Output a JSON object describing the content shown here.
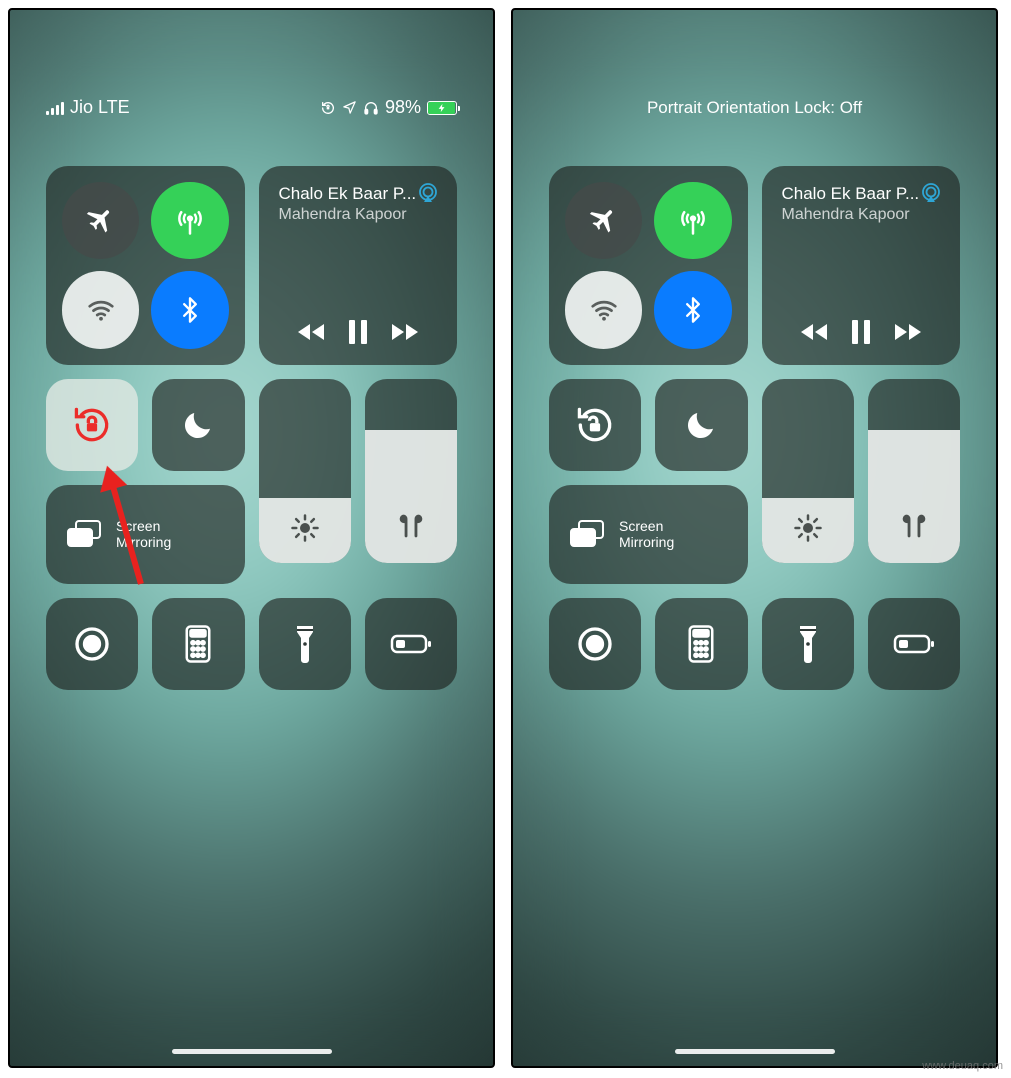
{
  "watermark": "www.deuaq.com",
  "left": {
    "status": {
      "carrier": "Jio LTE",
      "battery_percent": "98%",
      "has_lock_indicator": true
    },
    "connectivity": {
      "airplane": false,
      "cellular": true,
      "wifi": true,
      "bluetooth": true
    },
    "media": {
      "title": "Chalo Ek Baar P...",
      "artist": "Mahendra Kapoor",
      "playing": true
    },
    "orientation_lock": {
      "on": true
    },
    "dnd": {
      "on": false
    },
    "screen_mirroring": {
      "label": "Screen\nMirroring"
    },
    "brightness_pct": 35,
    "volume_pct": 72,
    "shortcuts": [
      "screen-record",
      "calculator",
      "flashlight",
      "low-power"
    ],
    "annotation_arrow": true
  },
  "right": {
    "status": {
      "title": "Portrait Orientation Lock: Off"
    },
    "connectivity": {
      "airplane": false,
      "cellular": true,
      "wifi": true,
      "bluetooth": true
    },
    "media": {
      "title": "Chalo Ek Baar P...",
      "artist": "Mahendra Kapoor",
      "playing": true
    },
    "orientation_lock": {
      "on": false
    },
    "dnd": {
      "on": false
    },
    "screen_mirroring": {
      "label": "Screen\nMirroring"
    },
    "brightness_pct": 35,
    "volume_pct": 72,
    "shortcuts": [
      "screen-record",
      "calculator",
      "flashlight",
      "low-power"
    ]
  }
}
